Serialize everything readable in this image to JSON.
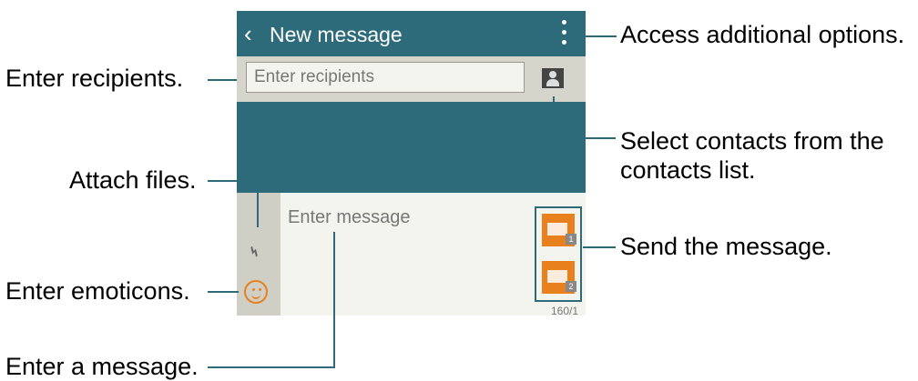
{
  "appbar": {
    "title": "New message"
  },
  "recipients": {
    "placeholder": "Enter recipients"
  },
  "composer": {
    "placeholder": "Enter message",
    "counter": "160/1",
    "sim1": "1",
    "sim2": "2"
  },
  "callouts": {
    "options": "Access additional options.",
    "recipients": "Enter recipients.",
    "contacts_line1": "Select contacts from the",
    "contacts_line2": "contacts list.",
    "attach": "Attach files.",
    "send": "Send the message.",
    "emoticons": "Enter emoticons.",
    "message": "Enter a message."
  },
  "icons": [
    "back-arrow-icon",
    "more-options-icon",
    "contact-icon",
    "paperclip-icon",
    "emoticon-icon",
    "send-icon"
  ]
}
